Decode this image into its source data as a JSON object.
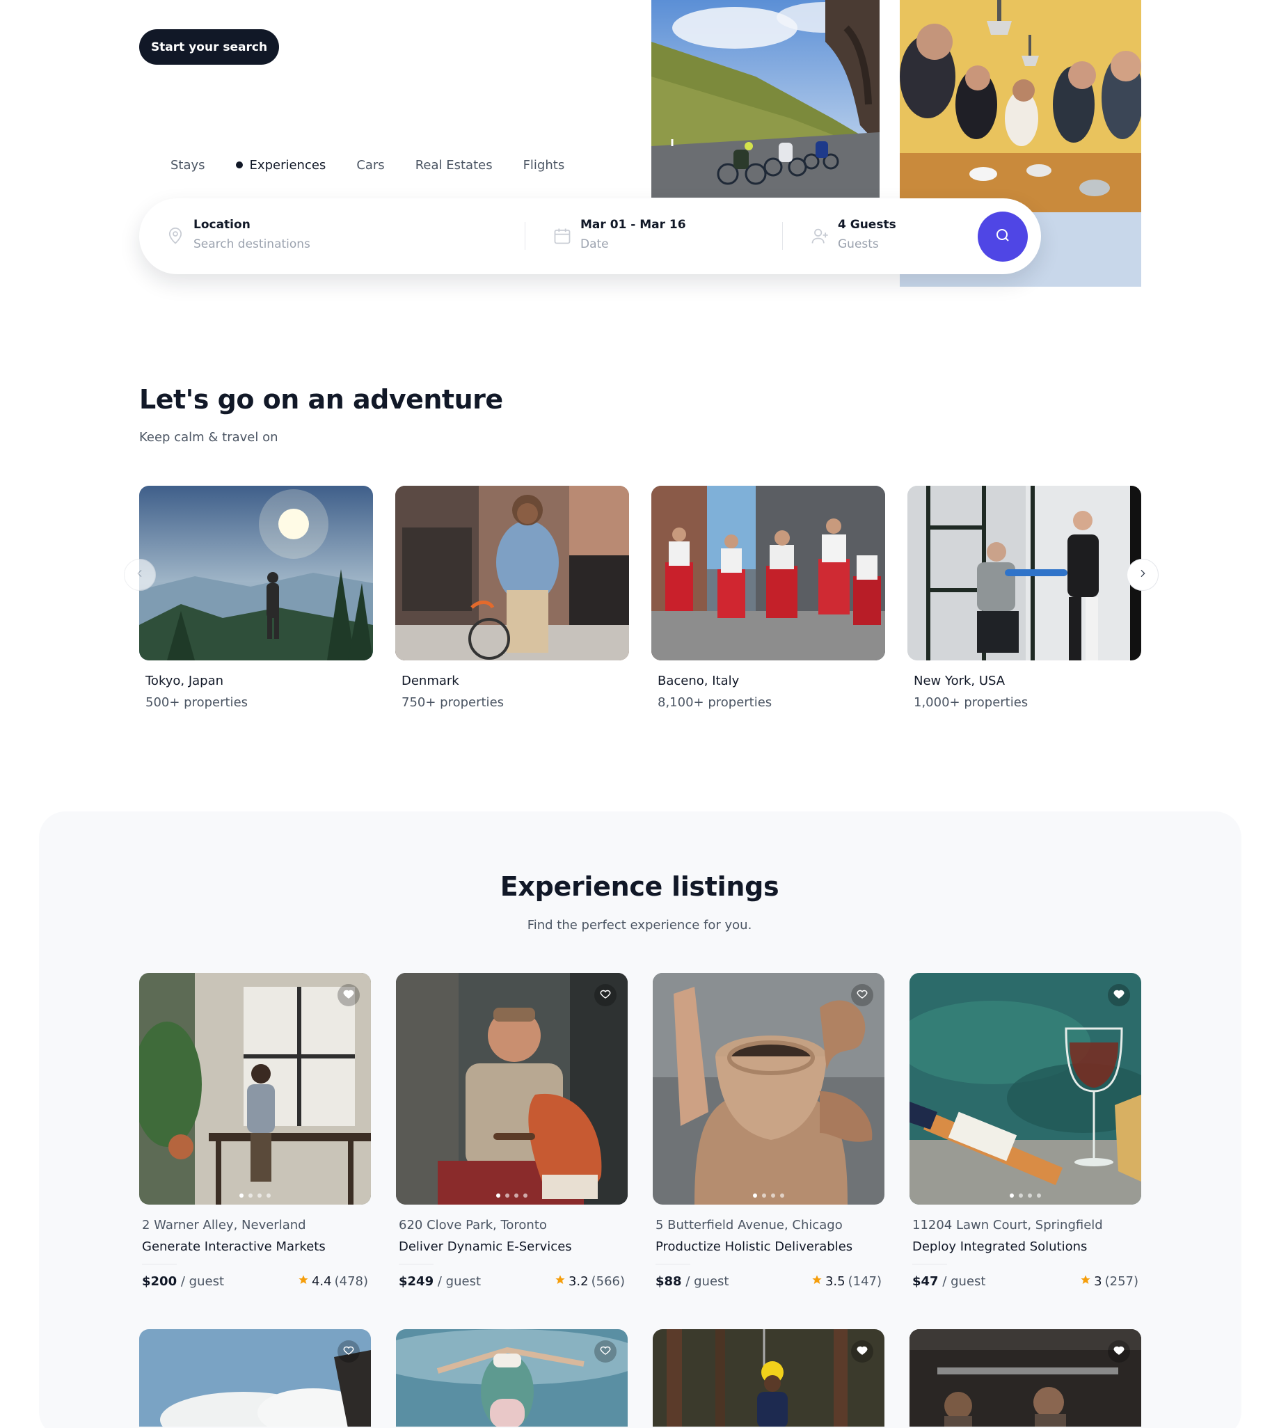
{
  "hero": {
    "start_button": "Start your search",
    "tabs": [
      {
        "label": "Stays",
        "active": false
      },
      {
        "label": "Experiences",
        "active": true
      },
      {
        "label": "Cars",
        "active": false
      },
      {
        "label": "Real Estates",
        "active": false
      },
      {
        "label": "Flights",
        "active": false
      }
    ],
    "search": {
      "location_title": "Location",
      "location_placeholder": "Search destinations",
      "date_title": "Mar 01 - Mar 16",
      "date_sub": "Date",
      "guests_title": "4 Guests",
      "guests_sub": "Guests",
      "location_icon": "map-pin-icon",
      "date_icon": "calendar-icon",
      "guests_icon": "user-plus-icon",
      "submit_icon": "search-icon"
    }
  },
  "adventure": {
    "title": "Let's go on an adventure",
    "subtitle": "Keep calm & travel on",
    "destinations": [
      {
        "name": "Tokyo, Japan",
        "count": "500+ properties"
      },
      {
        "name": "Denmark",
        "count": "750+ properties"
      },
      {
        "name": "Baceno, Italy",
        "count": "8,100+ properties"
      },
      {
        "name": "New York, USA",
        "count": "1,000+ properties"
      }
    ]
  },
  "listings": {
    "title": "Experience listings",
    "subtitle": "Find the perfect experience for you.",
    "cards": [
      {
        "address": "2 Warner Alley, Neverland",
        "title": "Generate Interactive Markets",
        "price": "$200",
        "unit": "guest",
        "rating": "4.4",
        "reviews": "(478)",
        "liked": true
      },
      {
        "address": "620 Clove Park, Toronto",
        "title": "Deliver Dynamic E-Services",
        "price": "$249",
        "unit": "guest",
        "rating": "3.2",
        "reviews": "(566)",
        "liked": false
      },
      {
        "address": "5 Butterfield Avenue, Chicago",
        "title": "Productize Holistic Deliverables",
        "price": "$88",
        "unit": "guest",
        "rating": "3.5",
        "reviews": "(147)",
        "liked": false
      },
      {
        "address": "11204 Lawn Court, Springfield",
        "title": "Deploy Integrated Solutions",
        "price": "$47",
        "unit": "guest",
        "rating": "3",
        "reviews": "(257)",
        "liked": true
      }
    ],
    "price_separator": "/",
    "accent_star": "#f59e0b"
  },
  "colors": {
    "primary": "#4f46e5",
    "dark": "#111827",
    "muted": "#4b5563"
  }
}
